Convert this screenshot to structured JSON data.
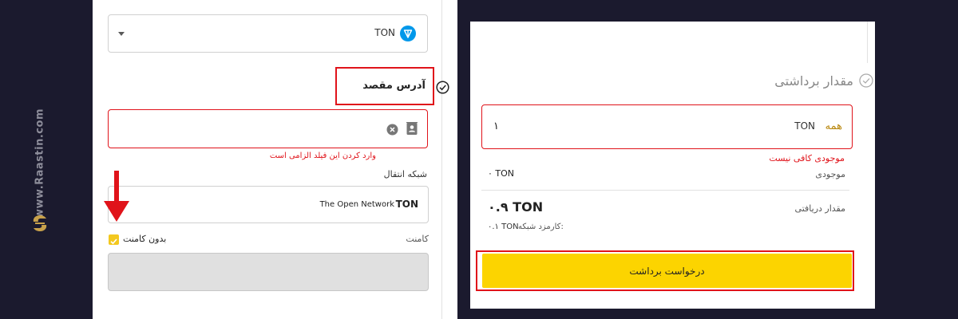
{
  "watermark": {
    "text": "www.Raastin.com"
  },
  "withdraw_form": {
    "coin": {
      "label": "TON",
      "icon": "ton-logo-icon"
    },
    "destination": {
      "title": "آدرس مقصد",
      "address_placeholder": "",
      "error": "وارد کردن این فیلد الزامی است"
    },
    "network": {
      "label": "شبکه انتقال",
      "code": "TON",
      "name": "The Open Network"
    },
    "comment": {
      "label": "کامنت",
      "no_comment_label": "بدون کامنت",
      "no_comment_checked": true,
      "value": ""
    }
  },
  "amount_panel": {
    "title": "مقدار برداشتی",
    "all_button": "همه",
    "coin": "TON",
    "value": "۱",
    "error": "موجودی کافی نیست",
    "balance": {
      "label": "موجودی",
      "value": "۰ TON"
    },
    "receive": {
      "label": "مقدار دریافتی",
      "value": "۰.۹ TON"
    },
    "fee": {
      "label": "کارمزد شبکه:",
      "value": "۰.۱ TON"
    },
    "submit_label": "درخواست برداشت"
  },
  "colors": {
    "accent_yellow": "#fcd400",
    "error_red": "#e0131a",
    "ton_blue": "#0098ea",
    "background": "#1b1a2e"
  }
}
